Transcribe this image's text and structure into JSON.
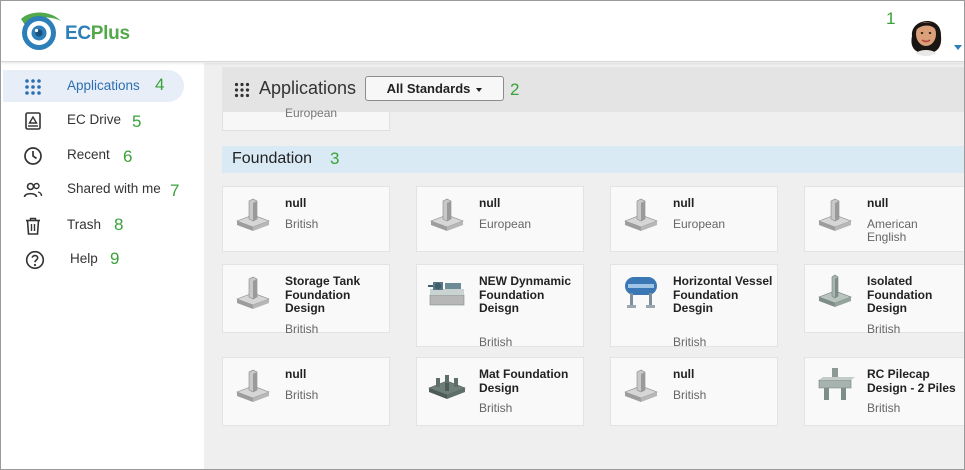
{
  "header": {
    "logo_ec": "EC",
    "logo_plus": "Plus",
    "annotation": "1"
  },
  "sidebar": {
    "items": [
      {
        "label": "Applications",
        "icon": "apps-grid-icon",
        "annotation": "4",
        "active": true
      },
      {
        "label": "EC Drive",
        "icon": "drive-icon",
        "annotation": "5"
      },
      {
        "label": "Recent",
        "icon": "clock-icon",
        "annotation": "6"
      },
      {
        "label": "Shared with me",
        "icon": "people-icon",
        "annotation": "7"
      },
      {
        "label": "Trash",
        "icon": "trash-icon",
        "annotation": "8"
      },
      {
        "label": "Help",
        "icon": "help-icon",
        "annotation": "9"
      }
    ]
  },
  "main": {
    "title": "Applications",
    "standards_button": "All Standards",
    "standards_annotation": "2",
    "previous_card_standard": "European",
    "section": {
      "title": "Foundation",
      "annotation": "3"
    },
    "cards": [
      {
        "title": "null",
        "standard": "British",
        "icon": "column-footing-icon"
      },
      {
        "title": "null",
        "standard": "European",
        "icon": "column-footing-icon"
      },
      {
        "title": "null",
        "standard": "European",
        "icon": "column-footing-icon"
      },
      {
        "title": "null",
        "standard": "American English",
        "icon": "column-footing-icon"
      },
      {
        "title": "Storage Tank Foundation Design",
        "standard": "British",
        "icon": "column-footing-icon"
      },
      {
        "title": "NEW Dynmamic Foundation Deisgn",
        "standard": "British",
        "icon": "machine-foundation-icon"
      },
      {
        "title": "Horizontal Vessel Foundation Desgin",
        "standard": "British",
        "icon": "horizontal-vessel-icon"
      },
      {
        "title": "Isolated Foundation Design",
        "standard": "British",
        "icon": "isolated-footing-icon"
      },
      {
        "title": "null",
        "standard": "British",
        "icon": "column-footing-icon"
      },
      {
        "title": "Mat Foundation Design",
        "standard": "British",
        "icon": "mat-foundation-icon"
      },
      {
        "title": "null",
        "standard": "British",
        "icon": "column-footing-icon"
      },
      {
        "title": "RC Pilecap Design - 2 Piles",
        "standard": "British",
        "icon": "pilecap-icon"
      }
    ]
  },
  "colors": {
    "brand_blue": "#2c7fb8",
    "brand_green": "#52a84b",
    "annotation_green": "#3aa13a",
    "section_bg": "#d9eaf5",
    "active_nav_bg": "#e8eef8"
  }
}
